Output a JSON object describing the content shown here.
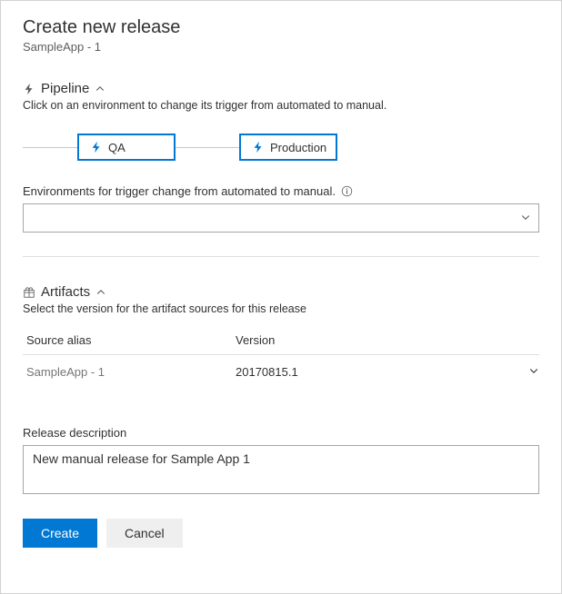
{
  "header": {
    "title": "Create new release",
    "subtitle": "SampleApp - 1"
  },
  "pipeline": {
    "section_title": "Pipeline",
    "description": "Click on an environment to change its trigger from automated to manual.",
    "stages": [
      {
        "label": "QA"
      },
      {
        "label": "Production"
      }
    ],
    "env_label": "Environments for trigger change from automated to manual.",
    "env_value": ""
  },
  "artifacts": {
    "section_title": "Artifacts",
    "description": "Select the version for the artifact sources for this release",
    "col_alias": "Source alias",
    "col_version": "Version",
    "rows": [
      {
        "alias": "SampleApp - 1",
        "version": "20170815.1"
      }
    ]
  },
  "description": {
    "label": "Release description",
    "value": "New manual release for Sample App 1"
  },
  "buttons": {
    "create": "Create",
    "cancel": "Cancel"
  }
}
